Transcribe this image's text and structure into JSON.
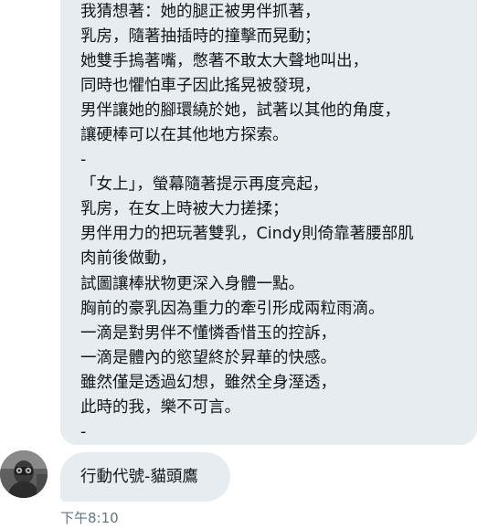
{
  "conversation": {
    "message_lines": [
      "我猜想著：她的腿正被男伴抓著，",
      "乳房，隨著抽插時的撞擊而晃動；",
      "她雙手摀著嘴，憋著不敢太大聲地叫出，",
      "同時也懼怕車子因此搖晃被發現，",
      "男伴讓她的腳環繞於她，試著以其他的角度，",
      "讓硬棒可以在其他地方探索。",
      "-",
      "「女上」，螢幕隨著提示再度亮起，",
      "乳房，在女上時被大力搓揉；",
      "男伴用力的把玩著雙乳，Cindy則倚靠著腰部肌",
      "肉前後做動，",
      "試圖讓棒狀物更深入身體一點。",
      "胸前的豪乳因為重力的牽引形成兩粒雨滴。",
      "一滴是對男伴不懂憐香惜玉的控訴，",
      "一滴是體內的慾望終於昇華的快感。",
      "雖然僅是透過幻想，雖然全身溼透，",
      "此時的我，樂不可言。",
      "-"
    ],
    "second_message": "行動代號-貓頭鷹",
    "timestamp": "下午8:10"
  },
  "colors": {
    "bubble_bg": "#e6ecf0",
    "text": "#14171a",
    "timestamp": "#657786"
  },
  "icons": {
    "avatar": "user-avatar-photo"
  }
}
